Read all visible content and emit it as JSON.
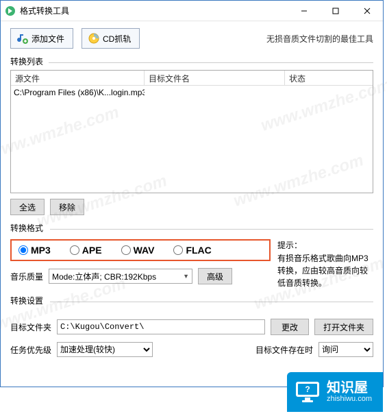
{
  "window": {
    "title": "格式转换工具"
  },
  "toolbar": {
    "add_file": "添加文件",
    "cd_rip": "CD抓轨",
    "tagline": "无损音质文件切割的最佳工具"
  },
  "list": {
    "label": "转换列表",
    "headers": {
      "src": "源文件",
      "dst": "目标文件名",
      "status": "状态"
    },
    "rows": [
      {
        "src": "C:\\Program Files (x86)\\K...login.mp3",
        "dst": "",
        "status": ""
      }
    ]
  },
  "buttons": {
    "select_all": "全选",
    "remove": "移除",
    "advanced": "高级",
    "change": "更改",
    "open_folder": "打开文件夹"
  },
  "format": {
    "label": "转换格式",
    "options": [
      "MP3",
      "APE",
      "WAV",
      "FLAC"
    ],
    "selected": "MP3",
    "quality_label": "音乐质量",
    "quality_value": "Mode:立体声; CBR:192Kbps",
    "tip_title": "提示：",
    "tip_body": "有损音乐格式歌曲向MP3转换，应由较高音质向较低音质转换。"
  },
  "settings": {
    "label": "转换设置",
    "dest_label": "目标文件夹",
    "dest_path": "C:\\Kugou\\Convert\\",
    "priority_label": "任务优先级",
    "priority_value": "加速处理(较快)",
    "exists_label": "目标文件存在时",
    "exists_value": "询问"
  },
  "logo": {
    "name": "知识屋",
    "domain": "zhishiwu.com"
  },
  "watermark": "www.wmzhe.com"
}
